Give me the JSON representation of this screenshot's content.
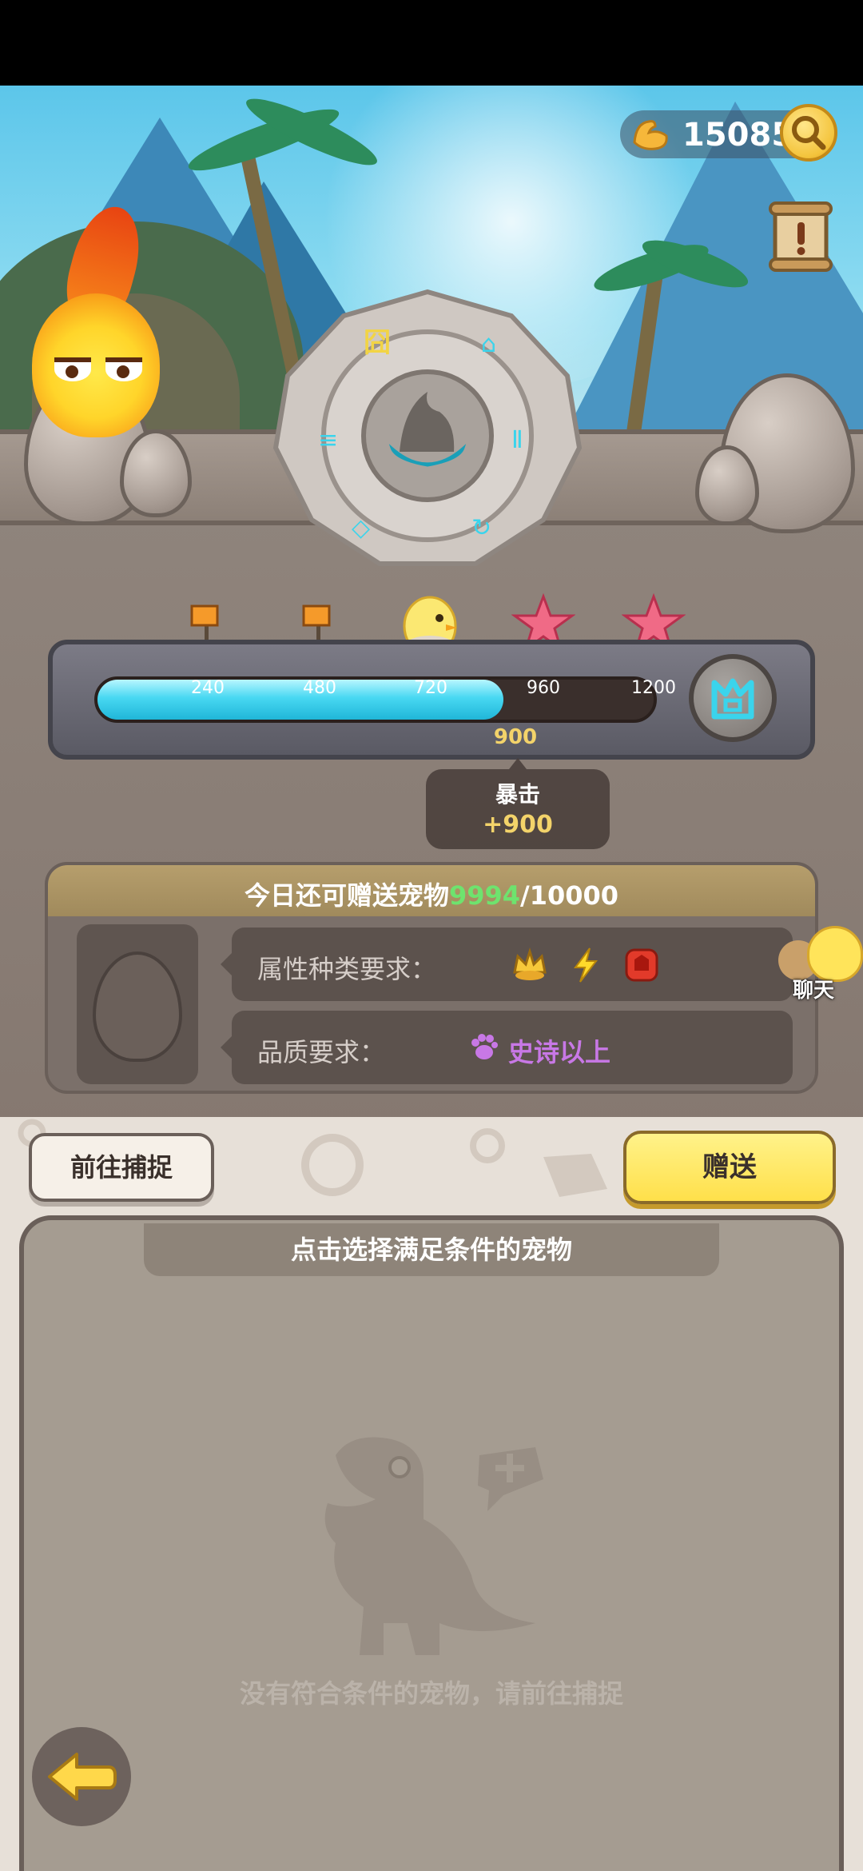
{
  "currency": {
    "icon": "arm-icon",
    "value": "15085"
  },
  "progress": {
    "ticks": [
      "240",
      "480",
      "720",
      "960",
      "1200"
    ],
    "current": "900",
    "fraction": 0.73,
    "max": 1200,
    "rewards": [
      "flag-icon",
      "flag-icon",
      "chick-pet-icon",
      "starfish-icon",
      "starfish-icon"
    ]
  },
  "crit": {
    "title": "暴击",
    "value": "+900"
  },
  "requirement": {
    "header_prefix": "今日还可赠送宠物",
    "header_remaining": "9994",
    "header_total": "/10000",
    "attr_label": "属性种类要求：",
    "attr_icons": [
      "crown-icon",
      "lightning-icon",
      "red-gem-icon"
    ],
    "quality_label": "品质要求：",
    "quality_value": "史诗以上",
    "quality_icon": "paw-icon"
  },
  "chat": {
    "label": "聊天"
  },
  "buttons": {
    "capture": "前往捕捉",
    "gift": "赠送"
  },
  "pet_list": {
    "header": "点击选择满足条件的宠物",
    "empty_text": "没有符合条件的宠物，请前往捕捉"
  },
  "colors": {
    "accent_green": "#6ee36e",
    "bar_fill": "#48d8f2",
    "gold": "#f3d36a",
    "quality_purple": "#c878e6"
  }
}
